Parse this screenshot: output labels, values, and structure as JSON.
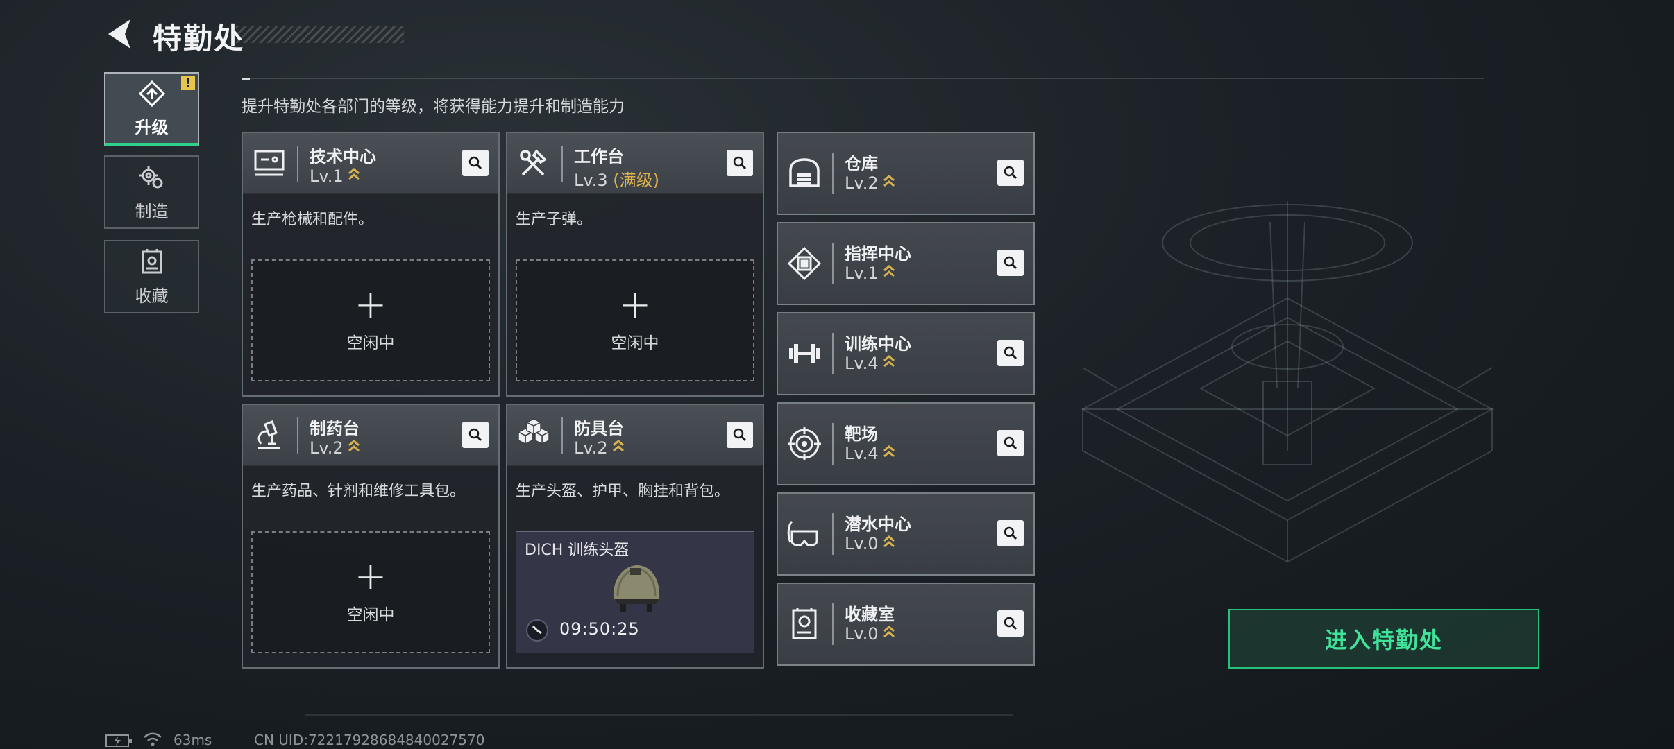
{
  "header": {
    "title": "特勤处"
  },
  "nav": {
    "items": [
      {
        "label": "升级",
        "active": true,
        "alert": "!"
      },
      {
        "label": "制造",
        "active": false
      },
      {
        "label": "收藏",
        "active": false
      }
    ]
  },
  "subtitle": "提升特勤处各部门的等级，将获得能力提升和制造能力",
  "cards": [
    {
      "name": "技术中心",
      "level": "Lv.1",
      "desc": "生产枪械和配件。",
      "slot": {
        "state": "idle",
        "label": "空闲中"
      }
    },
    {
      "name": "工作台",
      "level": "Lv.3",
      "max": "(满级)",
      "desc": "生产子弹。",
      "slot": {
        "state": "idle",
        "label": "空闲中"
      }
    },
    {
      "name": "制药台",
      "level": "Lv.2",
      "desc": "生产药品、针剂和维修工具包。",
      "slot": {
        "state": "idle",
        "label": "空闲中"
      }
    },
    {
      "name": "防具台",
      "level": "Lv.2",
      "desc": "生产头盔、护甲、胸挂和背包。",
      "slot": {
        "state": "producing",
        "item": "DICH 训练头盔",
        "time": "09:50:25"
      }
    }
  ],
  "facilities": [
    {
      "name": "仓库",
      "level": "Lv.2",
      "icon": "warehouse-icon"
    },
    {
      "name": "指挥中心",
      "level": "Lv.1",
      "icon": "command-chip-icon"
    },
    {
      "name": "训练中心",
      "level": "Lv.4",
      "icon": "dumbbell-icon"
    },
    {
      "name": "靶场",
      "level": "Lv.4",
      "icon": "target-icon"
    },
    {
      "name": "潜水中心",
      "level": "Lv.0",
      "icon": "diving-mask-icon"
    },
    {
      "name": "收藏室",
      "level": "Lv.0",
      "icon": "collection-case-icon"
    }
  ],
  "enter_button": "进入特勤处",
  "status": {
    "ping": "63ms",
    "uid": "CN UID:72217928684840027570"
  },
  "colors": {
    "accent": "#25c27c",
    "max_level": "#e0b24a",
    "alert": "#e7c44a"
  }
}
